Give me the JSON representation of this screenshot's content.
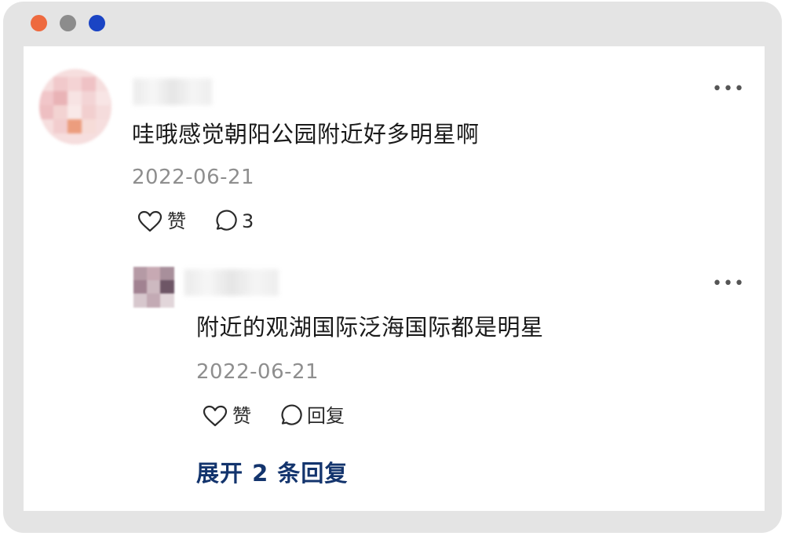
{
  "window": {
    "controls": [
      {
        "name": "close",
        "color": "#ee6a3f"
      },
      {
        "name": "minimize",
        "color": "#8c8c8c"
      },
      {
        "name": "maximize",
        "color": "#1a44c4"
      }
    ]
  },
  "comment": {
    "text": "哇哦感觉朝阳公园附近好多明星啊",
    "date": "2022-06-21",
    "like_label": "赞",
    "reply_count": "3",
    "more_icon": "more-icon"
  },
  "reply": {
    "text": "附近的观湖国际泛海国际都是明星",
    "date": "2022-06-21",
    "like_label": "赞",
    "reply_label": "回复",
    "more_icon": "more-icon"
  },
  "expand": {
    "label": "展开 2 条回复"
  },
  "colors": {
    "link": "#13346d",
    "date": "#8e8e8e",
    "frame": "#e4e4e4"
  }
}
